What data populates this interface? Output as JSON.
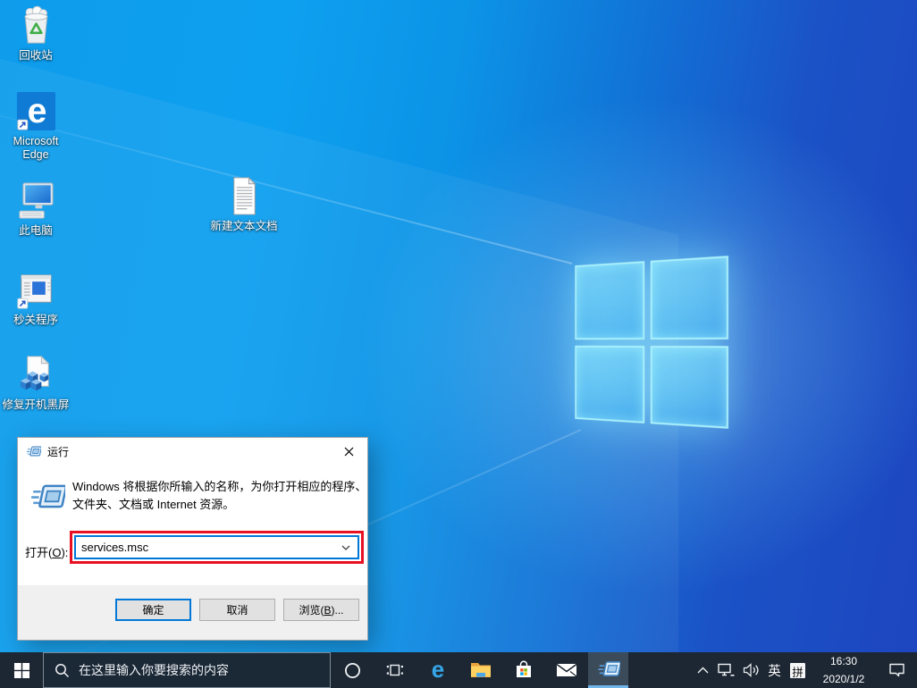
{
  "desktop": {
    "icons": [
      {
        "name": "recycle-bin",
        "label": "回收站"
      },
      {
        "name": "microsoft-edge",
        "label": "Microsoft Edge"
      },
      {
        "name": "this-pc",
        "label": "此电脑"
      },
      {
        "name": "quick-close-app",
        "label": "秒关程序"
      },
      {
        "name": "fix-boot-black-screen",
        "label": "修复开机黑屏"
      },
      {
        "name": "new-text-document",
        "label": "新建文本文档"
      }
    ]
  },
  "run_dialog": {
    "title": "运行",
    "description_line1": "Windows 将根据你所输入的名称，为你打开相应的程序、",
    "description_line2": "文件夹、文档或 Internet 资源。",
    "open_label": {
      "prefix": "打开(",
      "accel": "O",
      "suffix": "):"
    },
    "input_value": "services.msc",
    "buttons": {
      "ok": "确定",
      "cancel": "取消",
      "browse": {
        "prefix": "浏览(",
        "accel": "B",
        "suffix": ")..."
      }
    },
    "annotation_color": "#e81123"
  },
  "taskbar": {
    "search_placeholder": "在这里输入你要搜索的内容",
    "tray": {
      "ime_language": "英",
      "ime_input_mode": "拼",
      "time": "16:30",
      "date": "2020/1/2"
    }
  },
  "colors": {
    "taskbar_bg": "#1d2733",
    "accent": "#0078d7",
    "wallpaper_light": "#0ea0f0",
    "wallpaper_deep": "#1d46c0"
  }
}
